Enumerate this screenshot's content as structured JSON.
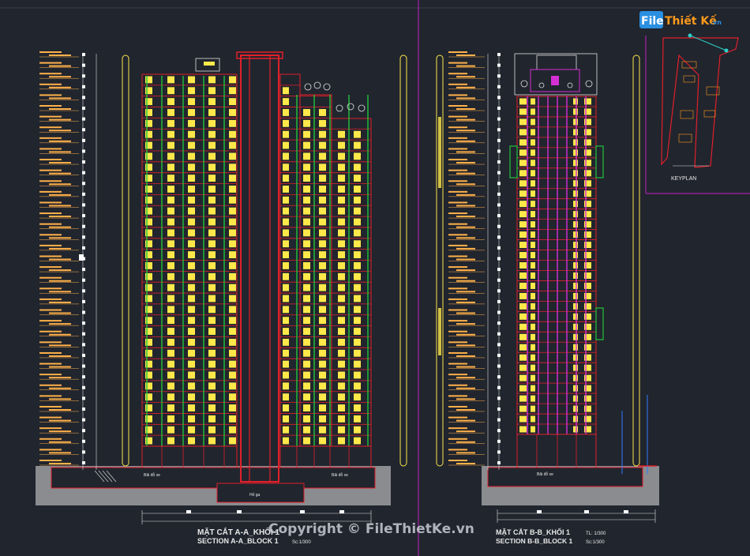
{
  "watermark": {
    "logo_left": "File",
    "logo_right": "Thiết Kế",
    "logo_suffix": ".vn",
    "copyright": "Copyright © FileThietKe.vn",
    "colors": {
      "blue": "#2a8fe0",
      "orange": "#ff9a1a"
    }
  },
  "section_a": {
    "title_vn": "MẶT CẮT A-A_KHỐI 1",
    "title_en": "SECTION A-A_BLOCK 1",
    "scale": "Sc:1/300",
    "basement_label_left": "Bãi đỗ xe",
    "basement_label_right": "Bãi đỗ xe",
    "bottom_label": "Hố ga"
  },
  "section_b": {
    "title_vn": "MẶT CẮT B-B_KHỐI 1",
    "title_en": "SECTION B-B_BLOCK 1",
    "scale_top": "TL: 1/300",
    "scale": "Sc:1/300",
    "basement_label": "Bãi đỗ xe"
  },
  "keyplan": {
    "label": "KEYPLAN"
  },
  "colors": {
    "background": "#21252e",
    "structure_red": "#e0202a",
    "window_yellow": "#ffe84a",
    "column_green": "#22c43a",
    "core_magenta": "#d430d4",
    "level_orange": "#ffb14a",
    "ground_gray": "#8a8c90"
  }
}
